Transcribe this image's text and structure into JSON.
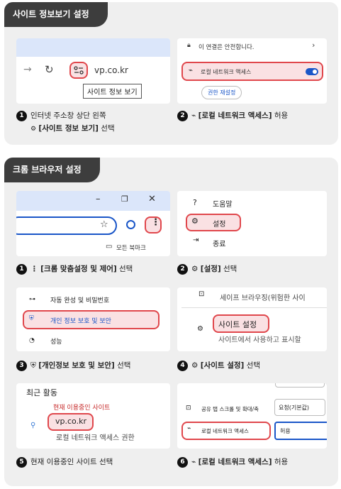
{
  "section1": {
    "title": "사이트 정보보기 설정",
    "card1": {
      "url": "vp.co.kr",
      "tooltip": "사이트 정보 보기"
    },
    "card2": {
      "secure": "이 연결은 안전합니다.",
      "local_net": "로컬 네트워크 액세스",
      "reset": "권한 재설정"
    },
    "cap1": {
      "line1": "인터넷 주소창 상단 왼쪽",
      "bold": "[사이트 정보 보기]",
      "rest": " 선택"
    },
    "cap2": {
      "bold": "[로컬 네트워크 액세스]",
      "rest": " 허용"
    }
  },
  "section2": {
    "title": "크롬 브라우저 설정",
    "card3": {
      "bookmarks": "모든 북마크"
    },
    "card4": {
      "help": "도움말",
      "settings": "설정",
      "exit": "종료"
    },
    "card5": {
      "autofill": "자동 완성 및 비밀번호",
      "privacy": "개인 정보 보호 및 보안",
      "performance": "성능"
    },
    "card6": {
      "safe_browsing": "세이프 브라우징(위험한 사이",
      "site_settings": "사이트 설정",
      "site_desc": "사이트에서 사용하고 표시할"
    },
    "card7": {
      "recent": "최근 활동",
      "current": "현재 이용중인 사이트",
      "site": "vp.co.kr",
      "local": "로컬 네트워크 액세스 권한"
    },
    "card8": {
      "share": "공유 탭 스크롤 및 확대/축",
      "share_val": "요청(기본값)",
      "local": "로컬 네트워크 액세스",
      "local_val": "허용"
    },
    "cap1": {
      "bold": "[크롬 맞춤설정 및 제어]",
      "rest": " 선택"
    },
    "cap2": {
      "bold": "[설정]",
      "rest": " 선택"
    },
    "cap3": {
      "bold": "[개인정보 보호 및 보안]",
      "rest": " 선택"
    },
    "cap4": {
      "bold": "[사이트 설정]",
      "rest": " 선택"
    },
    "cap5": {
      "text": "현재 이용중인 사이트 선택"
    },
    "cap6": {
      "bold": "[로컬 네트워크 액세스]",
      "rest": " 허용"
    }
  },
  "numbers": [
    "1",
    "2",
    "3",
    "4",
    "5",
    "6"
  ],
  "colors": {
    "highlight": "#e0474c",
    "dark": "#3d3d3d",
    "accent": "#1a56c8"
  }
}
